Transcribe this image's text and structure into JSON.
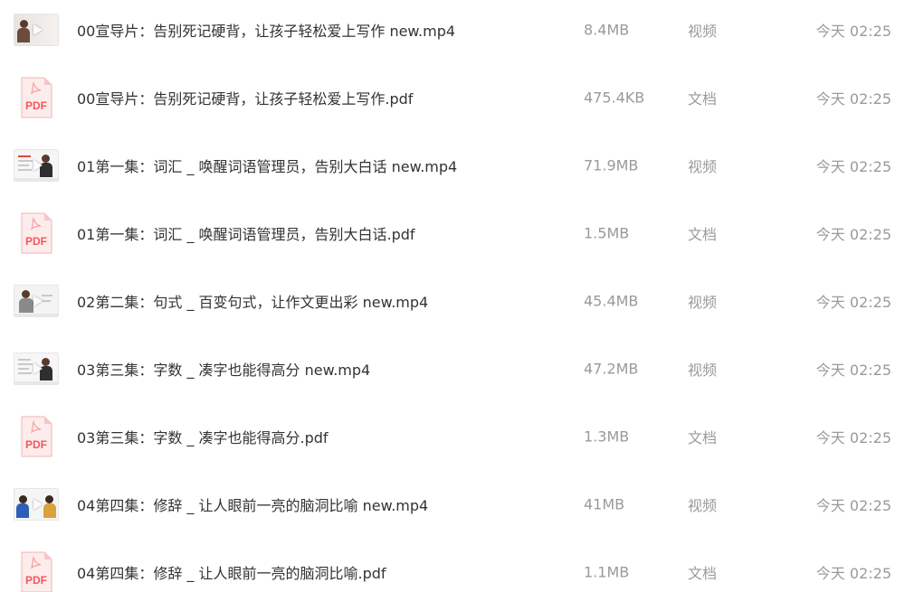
{
  "files": [
    {
      "name": "00宣导片：告别死记硬背，让孩子轻松爱上写作 new.mp4",
      "size": "8.4MB",
      "type": "视频",
      "time": "今天 02:25",
      "kind": "video"
    },
    {
      "name": "00宣导片：告别死记硬背，让孩子轻松爱上写作.pdf",
      "size": "475.4KB",
      "type": "文档",
      "time": "今天 02:25",
      "kind": "pdf"
    },
    {
      "name": "01第一集：词汇 _ 唤醒词语管理员，告别大白话 new.mp4",
      "size": "71.9MB",
      "type": "视频",
      "time": "今天 02:25",
      "kind": "video"
    },
    {
      "name": "01第一集：词汇 _ 唤醒词语管理员，告别大白话.pdf",
      "size": "1.5MB",
      "type": "文档",
      "time": "今天 02:25",
      "kind": "pdf"
    },
    {
      "name": "02第二集：句式 _ 百变句式，让作文更出彩 new.mp4",
      "size": "45.4MB",
      "type": "视频",
      "time": "今天 02:25",
      "kind": "video"
    },
    {
      "name": "03第三集：字数 _ 凑字也能得高分 new.mp4",
      "size": "47.2MB",
      "type": "视频",
      "time": "今天 02:25",
      "kind": "video"
    },
    {
      "name": "03第三集：字数 _ 凑字也能得高分.pdf",
      "size": "1.3MB",
      "type": "文档",
      "time": "今天 02:25",
      "kind": "pdf"
    },
    {
      "name": "04第四集：修辞 _ 让人眼前一亮的脑洞比喻 new.mp4",
      "size": "41MB",
      "type": "视频",
      "time": "今天 02:25",
      "kind": "video"
    },
    {
      "name": "04第四集：修辞 _ 让人眼前一亮的脑洞比喻.pdf",
      "size": "1.1MB",
      "type": "文档",
      "time": "今天 02:25",
      "kind": "pdf"
    }
  ],
  "icons": {
    "pdf_label": "PDF",
    "pdf_color": "#f0585a",
    "pdf_bg": "#fde8e8"
  }
}
